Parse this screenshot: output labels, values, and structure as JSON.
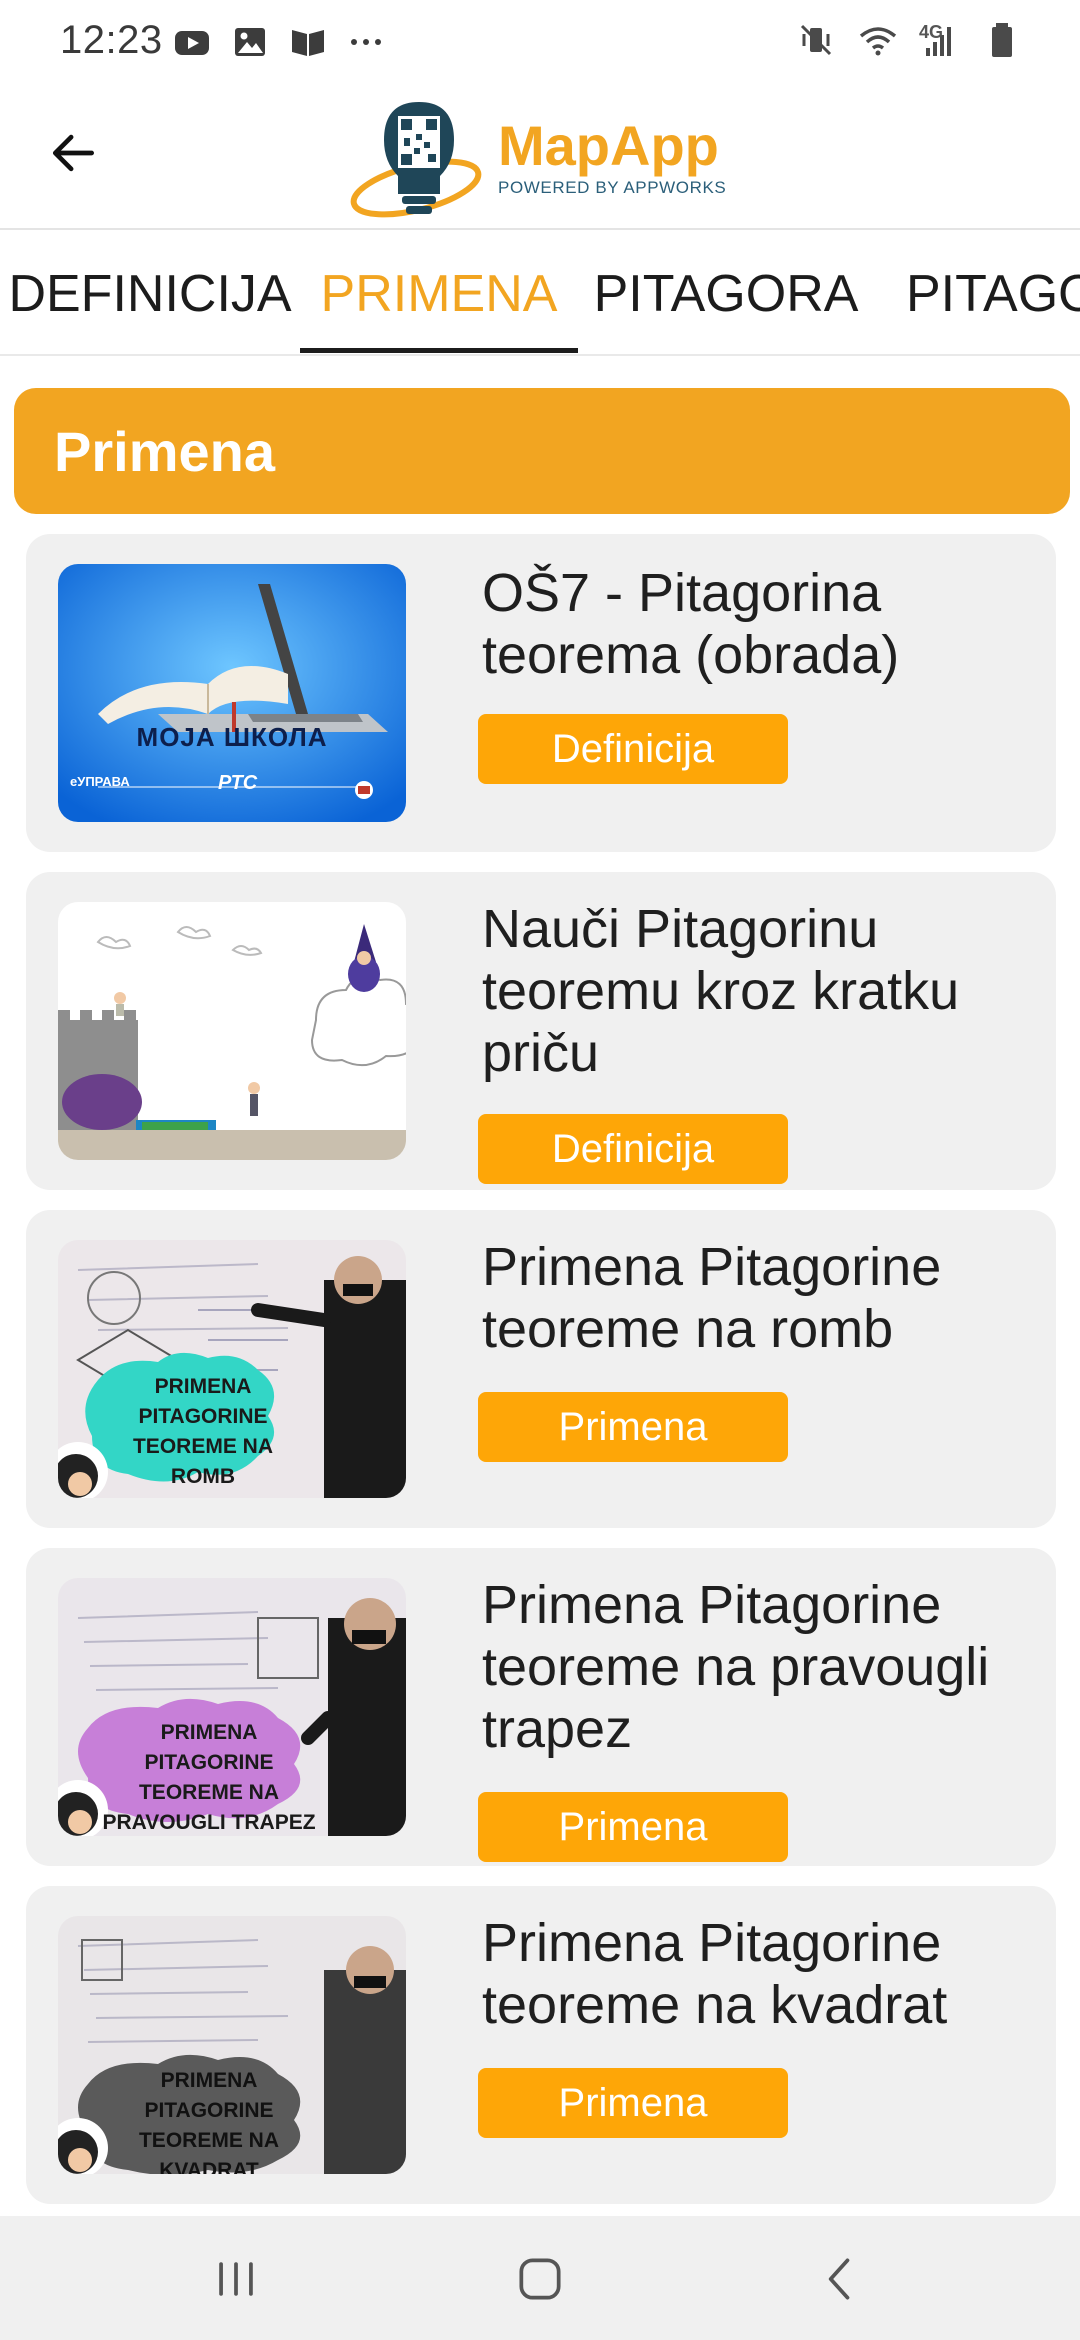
{
  "status_bar": {
    "time": "12:23",
    "network": "4G",
    "left_icons": [
      "youtube-icon",
      "gallery-icon",
      "book-icon",
      "more-dots-icon"
    ],
    "right_icons": [
      "vibrate-mute-icon",
      "wifi-icon",
      "signal-icon",
      "battery-icon"
    ]
  },
  "header": {
    "back_icon": "arrow-left-icon",
    "logo_title": "MapApp",
    "logo_subtitle": "POWERED BY APPWORKS"
  },
  "tabs": [
    {
      "label": "DEFINICIJA",
      "active": false
    },
    {
      "label": "PRIMENA",
      "active": true
    },
    {
      "label": "PITAGORA",
      "active": false
    },
    {
      "label": "PITAGOR",
      "active": false
    }
  ],
  "section": {
    "title": "Primena"
  },
  "items": [
    {
      "title": "OŠ7 - Pitagorina teorema (obrada)",
      "button": "Definicija",
      "thumbnail_caption": "МОЈА ШКОЛА",
      "thumbnail_logo_left": "еУПРАВА",
      "thumbnail_logo_mid": "РТС"
    },
    {
      "title": "Nauči Pitagorinu teoremu kroz kratku priču",
      "button": "Definicija",
      "thumbnail_caption": ""
    },
    {
      "title": "Primena Pitagorine teoreme na romb",
      "button": "Primena",
      "thumbnail_caption": "PRIMENA PITAGORINE TEOREME NA ROMB"
    },
    {
      "title": "Primena Pitagorine teoreme na pravougli trapez",
      "button": "Primena",
      "thumbnail_caption": "PRIMENA PITAGORINE TEOREME NA PRAVOUGLI TRAPEZ"
    },
    {
      "title": "Primena Pitagorine teoreme na kvadrat",
      "button": "Primena",
      "thumbnail_caption": "PRIMENA PITAGORINE TEOREME NA KVADRAT"
    }
  ],
  "navbar": {
    "icons": [
      "recent-apps-icon",
      "home-icon",
      "back-icon"
    ]
  },
  "colors": {
    "accent": "#f2a521",
    "button": "#fea607",
    "card_bg": "#f0f0f0",
    "text": "#1f1f1f"
  }
}
